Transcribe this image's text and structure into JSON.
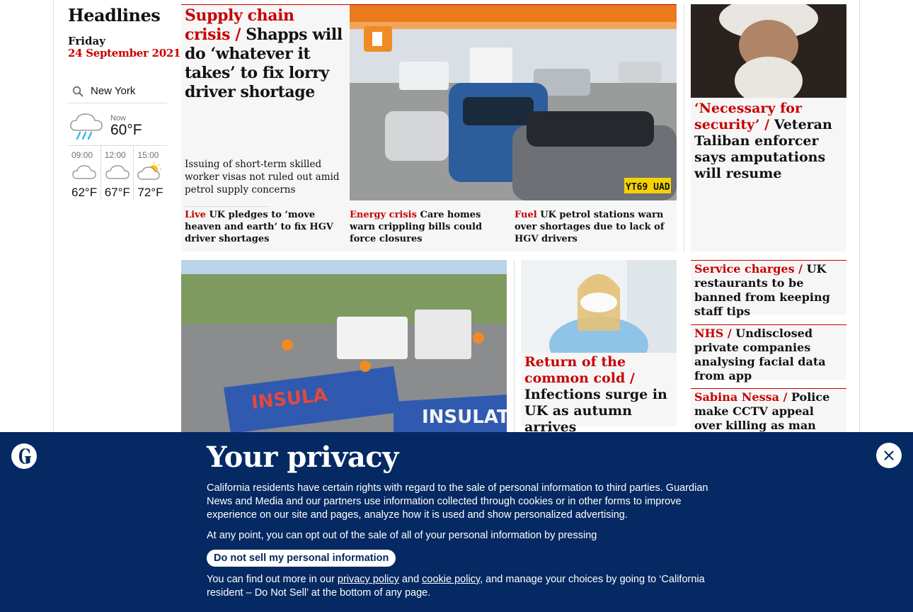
{
  "sidebar": {
    "title": "Headlines",
    "day": "Friday",
    "date": "24 September 2021"
  },
  "weather": {
    "location": "New York",
    "now_label": "Now",
    "now_temp": "60°F",
    "now_icon": "rain-cloud-icon",
    "forecast": [
      {
        "time": "09:00",
        "temp": "62°F",
        "icon": "cloud-icon"
      },
      {
        "time": "12:00",
        "temp": "67°F",
        "icon": "cloud-icon"
      },
      {
        "time": "15:00",
        "temp": "72°F",
        "icon": "sun-cloud-icon"
      }
    ]
  },
  "lead": {
    "kicker": "Supply chain crisis /",
    "headline": "Shapps will do ‘whatever it takes’ to fix lorry driver shortage",
    "standfirst": "Issuing of short-term skilled worker visas not ruled out amid petrol supply concerns",
    "sublinks": [
      {
        "kicker": "Live",
        "text": "UK pledges to ‘move heaven and earth’ to fix HGV driver shortages"
      },
      {
        "kicker": "Energy crisis",
        "text": "Care homes warn crippling bills could force closures"
      },
      {
        "kicker": "Fuel",
        "text": "UK petrol stations warn over shortages due to lack of HGV drivers"
      }
    ]
  },
  "right_feature": {
    "kicker": "‘Necessary for security’ /",
    "headline": "Veteran Taliban enforcer says amputations will resume"
  },
  "cold_card": {
    "kicker": "Return of the common cold /",
    "headline": "Infections surge in UK as autumn arrives"
  },
  "stack": [
    {
      "kicker": "Service charges /",
      "headline": "UK restaurants to be banned from keeping staff tips"
    },
    {
      "kicker": "NHS /",
      "headline": "Undisclosed private companies analysing facial data from app"
    },
    {
      "kicker": "Sabina Nessa /",
      "headline": "Police make CCTV appeal over killing as man held"
    }
  ],
  "privacy": {
    "title": "Your privacy",
    "paragraph1": "California residents have certain rights with regard to the sale of personal information to third parties. Guardian News and Media and our partners use information collected through cookies or in other forms to improve experience on our site and pages, analyze how it is used and show personalized advertising.",
    "paragraph2": "At any point, you can opt out of the sale of all of your personal information by pressing",
    "button_label": "Do not sell my personal information",
    "p3_before": "You can find out more in our ",
    "privacy_policy_link": "privacy policy",
    "p3_and": " and ",
    "cookie_policy_link": "cookie policy",
    "p3_after": ", and manage your choices by going to ‘California resident – Do Not Sell’ at the bottom of any page."
  },
  "colors": {
    "accent_red": "#c70000",
    "banner_blue": "#052962",
    "card_bg": "#f6f6f6"
  }
}
